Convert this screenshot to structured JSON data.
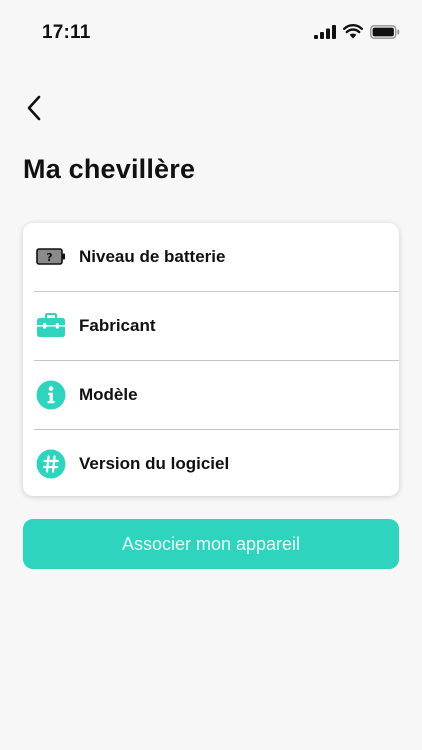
{
  "status_bar": {
    "time": "17:11"
  },
  "header": {
    "back_icon": "chevron-left-icon",
    "title": "Ma chevillère"
  },
  "info_card": {
    "rows": [
      {
        "icon": "battery-unknown-icon",
        "label": "Niveau de batterie"
      },
      {
        "icon": "toolbox-icon",
        "label": "Fabricant"
      },
      {
        "icon": "info-icon",
        "label": "Modèle"
      },
      {
        "icon": "hash-icon",
        "label": "Version du logiciel"
      }
    ]
  },
  "actions": {
    "associate_label": "Associer mon appareil"
  },
  "colors": {
    "accent": "#2fd4bf",
    "background": "#f7f7f7",
    "card": "#ffffff",
    "text": "#111111"
  }
}
